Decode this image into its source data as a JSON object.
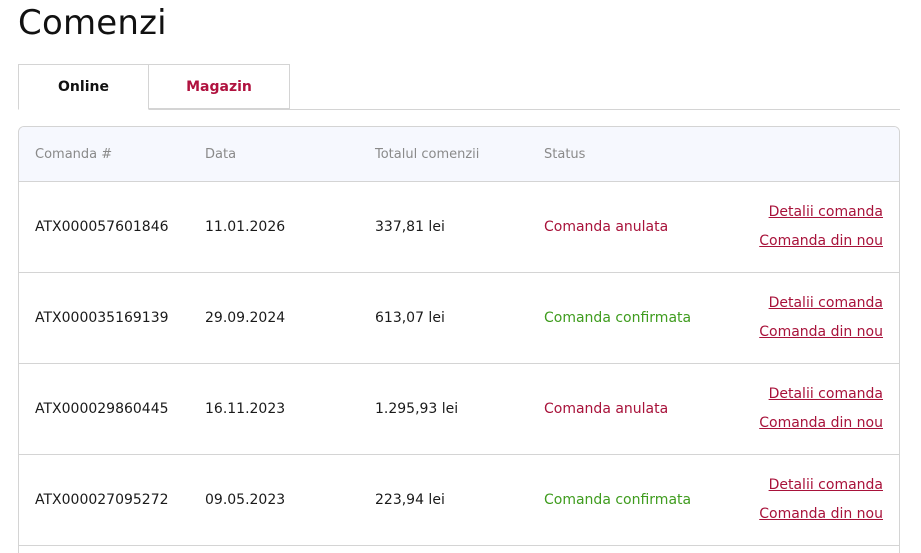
{
  "page": {
    "title": "Comenzi"
  },
  "tabs": [
    {
      "label": "Online"
    },
    {
      "label": "Magazin"
    }
  ],
  "table": {
    "headers": {
      "order": "Comanda #",
      "date": "Data",
      "total": "Totalul comenzii",
      "status": "Status"
    },
    "rows": [
      {
        "order": "ATX000057601846",
        "date": "11.01.2026",
        "total": "337,81 lei",
        "status": "Comanda anulata",
        "details": "Detalii comanda",
        "reorder": "Comanda din nou"
      },
      {
        "order": "ATX000035169139",
        "date": "29.09.2024",
        "total": "613,07 lei",
        "status": "Comanda confirmata",
        "details": "Detalii comanda",
        "reorder": "Comanda din nou"
      },
      {
        "order": "ATX000029860445",
        "date": "16.11.2023",
        "total": "1.295,93 lei",
        "status": "Comanda anulata",
        "details": "Detalii comanda",
        "reorder": "Comanda din nou"
      },
      {
        "order": "ATX000027095272",
        "date": "09.05.2023",
        "total": "223,94 lei",
        "status": "Comanda confirmata",
        "details": "Detalii comanda",
        "reorder": "Comanda din nou"
      }
    ]
  },
  "colors": {
    "brand": "#a8123a",
    "status_cancelled": "#a8123a",
    "status_confirmed": "#3f9c1e",
    "header_bg": "#f6f8fe"
  }
}
